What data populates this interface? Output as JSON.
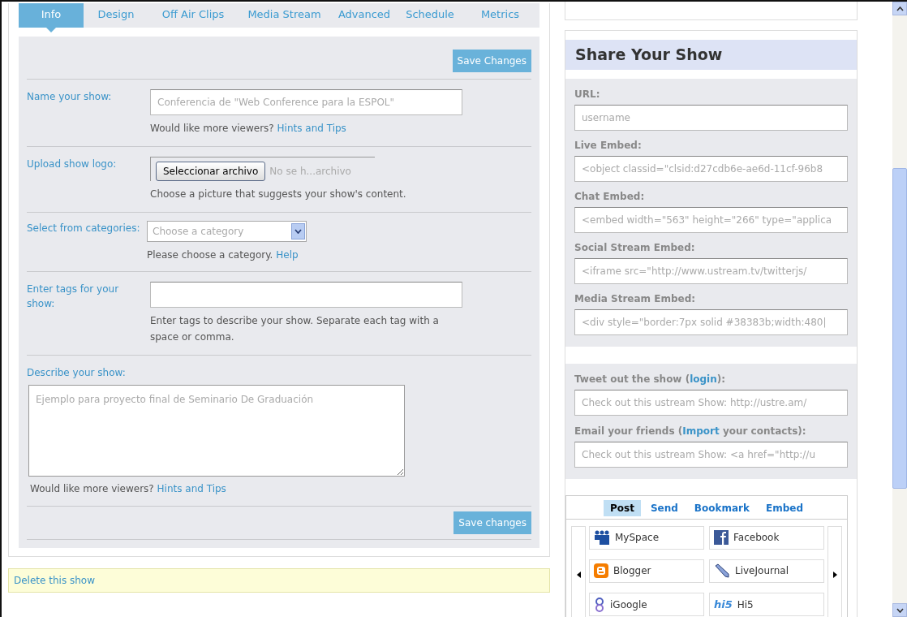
{
  "tabs": [
    {
      "label": "Info",
      "selected": true
    },
    {
      "label": "Design",
      "selected": false
    },
    {
      "label": "Off Air Clips",
      "selected": false
    },
    {
      "label": "Media Stream",
      "selected": false
    },
    {
      "label": "Advanced",
      "selected": false
    },
    {
      "label": "Schedule",
      "selected": false
    },
    {
      "label": "Metrics",
      "selected": false
    }
  ],
  "save_top": "Save Changes",
  "form": [
    {
      "kind": "text",
      "label": "Name your show:",
      "value": "Conferencia de \"Web Conference para la ESPOL\"",
      "hint": {
        "text": "Would like more viewers?",
        "link": "Hints and Tips"
      }
    },
    {
      "kind": "file",
      "label": "Upload show logo:",
      "button": "Seleccionar archivo",
      "file_status": "No se h...archivo",
      "hint": {
        "text": "Choose a picture that suggests your show's content."
      }
    },
    {
      "kind": "select",
      "label": "Select from categories:",
      "placeholder": "Choose a category",
      "hint": {
        "text": "Please choose a category.",
        "link": "Help"
      }
    },
    {
      "kind": "text",
      "label": "Enter tags for your show:",
      "hint": {
        "text": "Enter tags to describe your show. Separate each tag with a space or comma."
      }
    },
    {
      "kind": "textarea",
      "label": "Describe your show:",
      "value": "Ejemplo para proyecto final de Seminario De Graduación",
      "hint": {
        "text": "Would like more viewers?",
        "link": "Hints and Tips"
      }
    }
  ],
  "save_bottom": "Save changes",
  "delete_link": "Delete this show",
  "share": {
    "title": "Share Your Show",
    "embeds": [
      {
        "label": "URL:",
        "value": "username"
      },
      {
        "label": "Live Embed:",
        "value": "<object classid=\"clsid:d27cdb6e-ae6d-11cf-96b8"
      },
      {
        "label": "Chat Embed:",
        "value": "<embed width=\"563\" height=\"266\" type=\"applica"
      },
      {
        "label": "Social Stream Embed:",
        "value": "<iframe src=\"http://www.ustream.tv/twitterjs/"
      },
      {
        "label": "Media Stream Embed:",
        "value": "<div style=\"border:7px solid #38383b;width:480|"
      }
    ],
    "tweet": {
      "before": "Tweet out the show (",
      "link": "login",
      "after": "):",
      "value": "Check out this ustream Show: http://ustre.am/"
    },
    "email": {
      "before": "Email your friends (",
      "link": "Import",
      "after": " your contacts):",
      "value": "Check out this ustream Show: <a href=\"http://u"
    },
    "widget_tabs": [
      {
        "label": "Post",
        "selected": true
      },
      {
        "label": "Send",
        "selected": false
      },
      {
        "label": "Bookmark",
        "selected": false
      },
      {
        "label": "Embed",
        "selected": false
      }
    ],
    "services": [
      {
        "name": "MySpace"
      },
      {
        "name": "Facebook"
      },
      {
        "name": "Blogger"
      },
      {
        "name": "LiveJournal"
      },
      {
        "name": "iGoogle"
      },
      {
        "name": "Hi5",
        "logo": "hi5"
      }
    ]
  }
}
